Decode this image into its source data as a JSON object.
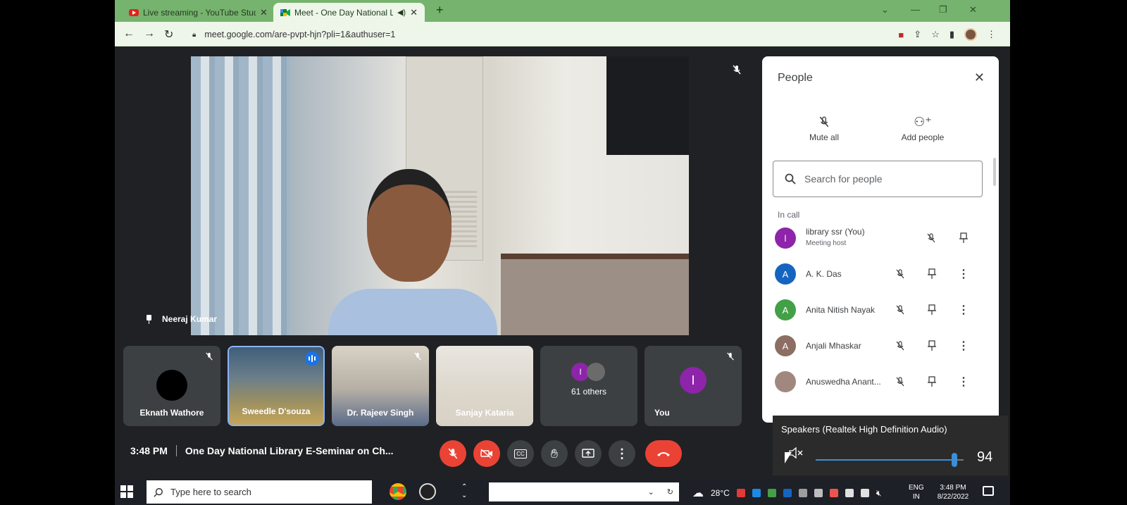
{
  "browser": {
    "tabs": [
      {
        "title": "Live streaming - YouTube Studio",
        "icon": "youtube-icon"
      },
      {
        "title": "Meet - One Day National Lib",
        "icon": "google-meet-icon"
      }
    ],
    "new_tab": "+",
    "url": "meet.google.com/are-pvpt-hjn?pli=1&authuser=1"
  },
  "main_video": {
    "presenter_name": "Neeraj Kumar"
  },
  "tiles": [
    {
      "name": "Eknath Wathore"
    },
    {
      "name": "Sweedle D'souza"
    },
    {
      "name": "Dr. Rajeev Singh"
    },
    {
      "name": "Sanjay Kataria"
    },
    {
      "name": "61 others",
      "avatar_letter": "I"
    },
    {
      "name": "You",
      "avatar_letter": "I"
    }
  ],
  "bottom_bar": {
    "time": "3:48 PM",
    "meeting_title": "One Day National Library E-Seminar on Ch..."
  },
  "people_panel": {
    "title": "People",
    "mute_all": "Mute all",
    "add_people": "Add people",
    "search_placeholder": "Search for people",
    "section_label": "In call",
    "participants": [
      {
        "letter": "l",
        "name": "library ssr (You)",
        "sub": "Meeting host",
        "color": "#8e24aa"
      },
      {
        "letter": "A",
        "name": "A. K. Das",
        "color": "#1565c0"
      },
      {
        "letter": "A",
        "name": "Anita Nitish Nayak",
        "color": "#43a047"
      },
      {
        "letter": "A",
        "name": "Anjali Mhaskar",
        "color": "#8d6e63"
      },
      {
        "letter": "",
        "name": "Anuswedha Anant...",
        "color": "#a1887f"
      }
    ]
  },
  "speaker_flyout": {
    "device": "Speakers (Realtek High Definition Audio)",
    "volume": 94
  },
  "taskbar": {
    "search_placeholder": "Type here to search",
    "weather": "28°C",
    "lang_line1": "ENG",
    "lang_line2": "IN",
    "time": "3:48 PM",
    "date": "8/22/2022"
  },
  "colors": {
    "meet_bg": "#202124",
    "tile_bg": "#3c4043",
    "red": "#ea4335",
    "accent": "#1a73e8",
    "chrome_green": "#76b36e"
  }
}
